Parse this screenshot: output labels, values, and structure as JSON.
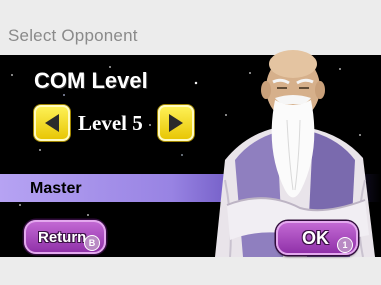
{
  "header": {
    "title": "Select Opponent"
  },
  "level_panel": {
    "heading": "COM Level",
    "level_label": "Level 5",
    "rank_label": "Master",
    "left_arrow_icon": "triangle-left-icon",
    "right_arrow_icon": "triangle-right-icon"
  },
  "buttons": {
    "return_label": "Return",
    "return_badge": "B",
    "ok_label": "OK",
    "ok_badge": "1"
  },
  "colors": {
    "arrow_yellow": "#f2d700",
    "button_purple": "#a94cc0",
    "band_lavender": "#9c89e6",
    "background": "#000000",
    "header_bg": "#ececec"
  }
}
